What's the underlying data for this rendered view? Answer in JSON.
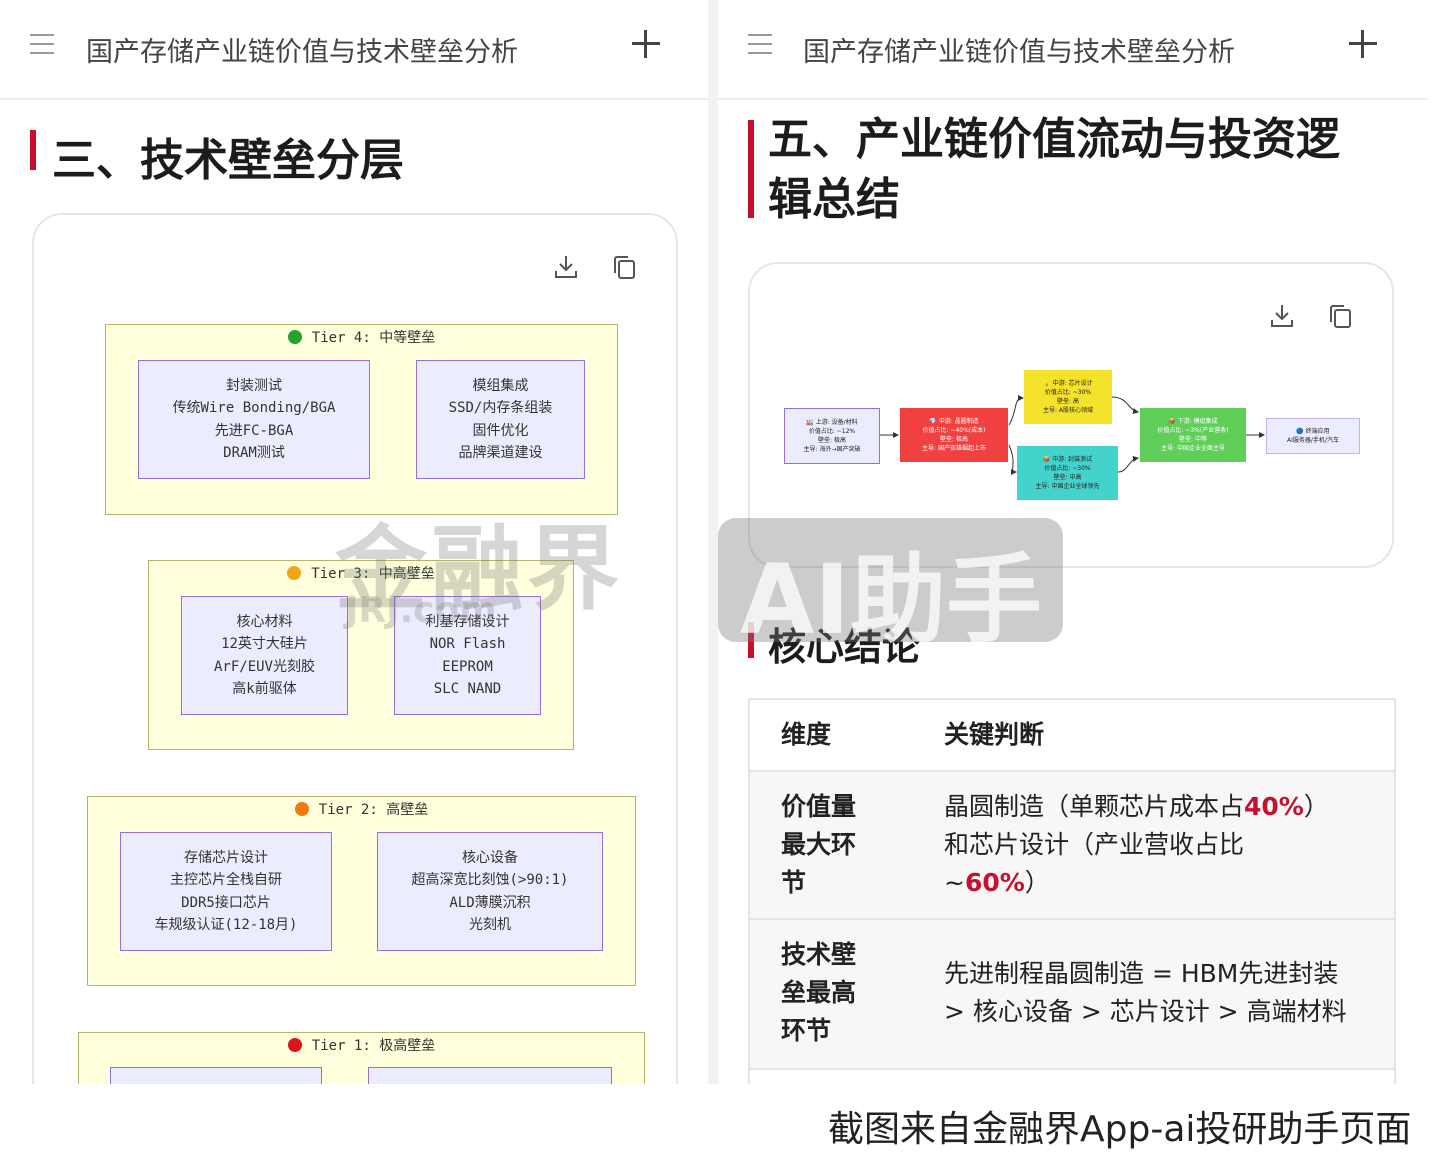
{
  "left": {
    "topbar_title": "国产存储产业链价值与技术壁垒分析",
    "section_title": "三、技术壁垒分层",
    "tiers": [
      {
        "label": "Tier 4: 中等壁垒",
        "dot_color": "#22a52a",
        "nodes": [
          [
            "封装测试",
            "传统Wire Bonding/BGA",
            "先进FC-BGA",
            "DRAM测试"
          ],
          [
            "模组集成",
            "SSD/内存条组装",
            "固件优化",
            "品牌渠道建设"
          ]
        ]
      },
      {
        "label": "Tier 3: 中高壁垒",
        "dot_color": "#f2a516",
        "nodes": [
          [
            "核心材料",
            "12英寸大硅片",
            "ArF/EUV光刻胶",
            "高k前驱体"
          ],
          [
            "利基存储设计",
            "NOR Flash",
            "EEPROM",
            "SLC NAND"
          ]
        ]
      },
      {
        "label": "Tier 2: 高壁垒",
        "dot_color": "#f07a12",
        "nodes": [
          [
            "存储芯片设计",
            "主控芯片全栈自研",
            "DDR5接口芯片",
            "车规级认证(12-18月)"
          ],
          [
            "核心设备",
            "超高深宽比刻蚀(>90:1)",
            "ALD薄膜沉积",
            "光刻机"
          ]
        ]
      },
      {
        "label": "Tier 1: 极高壁垒",
        "dot_color": "#d81818",
        "nodes": []
      }
    ]
  },
  "right": {
    "topbar_title": "国产存储产业链价值与技术壁垒分析",
    "section_title_line1": "五、产业链价值流动与投资逻",
    "section_title_line2": "辑总结",
    "flow": {
      "upstream": [
        "🏭 上游: 设备/材料",
        "价值占比: ~12%",
        "壁垒: 极高",
        "主导: 海外→国产突破"
      ],
      "midstream_wafer": [
        "💎 中游: 晶圆制造",
        "价值占比: ~40%(成本)",
        "壁垒: 极高",
        "主导: 国产双雄崛起上市"
      ],
      "midstream_design": [
        "💡 中游: 芯片设计",
        "价值占比: ~30%",
        "壁垒: 高",
        "主导: A股核心领域"
      ],
      "midstream_test": [
        "📦 中游: 封装测试",
        "价值占比: ~30%",
        "壁垒: 中高",
        "主导: 中国企业全球领先"
      ],
      "downstream": [
        "📦 下游: 模组集成",
        "价值占比: ~3%(产业营收)",
        "壁垒: 中等",
        "主导: 中国企业全面主导"
      ],
      "terminal": [
        "🔵 终端应用",
        "AI服务器/手机/汽车"
      ]
    },
    "conclusion_title": "核心结论",
    "table": {
      "header": [
        "维度",
        "关键判断"
      ],
      "rows": [
        {
          "dim": [
            "价值量",
            "最大环",
            "节"
          ],
          "line1_pre": "晶圆制造（单颗芯片成本占",
          "line1_hl": "40%",
          "line1_post": "）",
          "line2": "和芯片设计（产业营收占比",
          "line3_pre": "~",
          "line3_hl": "60%",
          "line3_post": "）"
        },
        {
          "dim": [
            "技术壁",
            "垒最高",
            "环节"
          ],
          "line1": "先进制程晶圆制造 = HBM先进封装",
          "line2": "> 核心设备 > 芯片设计 > 高端材料"
        }
      ]
    }
  },
  "watermark": {
    "brand": "金融界",
    "sub": "JRJ.com",
    "ai": "AI助手"
  },
  "caption": "截图来自金融界App-ai投研助手页面"
}
